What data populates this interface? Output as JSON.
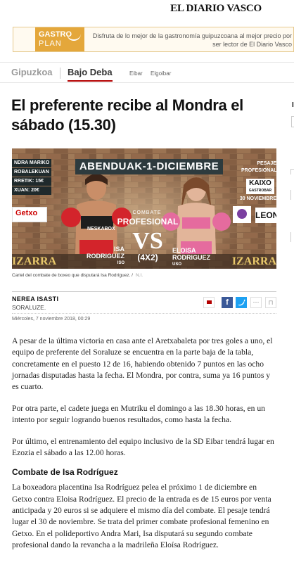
{
  "header": {
    "logo": "EL DIARIO VASCO"
  },
  "banner": {
    "logo_line1": "GASTRO",
    "logo_line2": "PLAN",
    "text": "Disfruta de lo mejor de la gastronomía guipuzcoana al mejor precio por ser lector de El Diario Vasco"
  },
  "nav": {
    "region": "Gipuzkoa",
    "section": "Bajo Deba",
    "sub": [
      "Eibar",
      "Elgoibar"
    ],
    "accent_color": "#b30000"
  },
  "article": {
    "headline": "El preferente recibe al Mondra el sábado (15.30)",
    "image": {
      "title": "ABENDUAK-1-DICIEMBRE",
      "left_lines": [
        "NDRA MARIKO",
        "ROBALEKUAN",
        "RRETIK: 15€",
        "XUAN: 20€"
      ],
      "sponsor_left": "Getxo",
      "right_lines": [
        "PESAJE",
        "PROFESIONAL"
      ],
      "sponsor_right": "KAIXO",
      "sponsor_right_sub": "GASTROBAR",
      "date_text": "30 NOVIEMBRE",
      "sponsor_leon": "LEON",
      "combate": "COMBATE",
      "profesional": "PROFESIONAL",
      "vs": "VS",
      "vs_format": "(4X2)",
      "boxer1_first": "ISA",
      "boxer1_last": "RODRIGUEZ",
      "boxer1_org": "ISO",
      "boxer2_first": "ELOISA",
      "boxer2_last": "RODRIGUEZ",
      "boxer2_org": "USO",
      "shirt_text": "NESKABOX",
      "bottom_left": "IZARRA",
      "bottom_right": "IZARRA"
    },
    "caption": "Cartel del combate de boxeo que disputará Isa Rodríguez. /",
    "caption_credit": "N.I.",
    "author": "NEREA ISASTI",
    "place": "SORALUZE.",
    "date": "Miércoles, 7 noviembre 2018, 00:29",
    "share": {
      "facebook": "f",
      "twitter": "t",
      "more": "···",
      "save": "⊓"
    },
    "paragraphs": [
      "A pesar de la última victoria en casa ante el Aretxabaleta por tres goles a uno, el equipo de preferente del Soraluze se encuentra en la parte baja de la tabla, concretamente en el puesto 12 de 16, habiendo obtenido 7 puntos en las ocho jornadas disputadas hasta la fecha. El Mondra, por contra, suma ya 16 puntos y es cuarto.",
      "Por otra parte, el cadete juega en Mutriku el domingo a las 18.30 horas, en un intento por seguir logrando buenos resultados, como hasta la fecha.",
      "Por último, el entrenamiento del equipo inclusivo de la SD Eibar tendrá lugar en Ezozia el sábado a las 12.00 horas."
    ],
    "subhead": "Combate de Isa Rodríguez",
    "paragraph_last": "La boxeadora placentina Isa Rodríguez pelea el próximo 1 de diciembre en Getxo contra Eloisa Rodríguez. El precio de la entrada es de 15 euros por venta anticipada y 20 euros si se adquiere el mismo día del combate. El pesaje tendrá lugar el 30 de noviembre. Se trata del primer combate profesional femenino en Getxo. En el polideportivo Andra Mari, Isa disputará su segundo combate profesional dando la revancha a la madrileña Eloísa Rodríguez."
  },
  "sidebar_cut": {
    "initial": "I"
  }
}
